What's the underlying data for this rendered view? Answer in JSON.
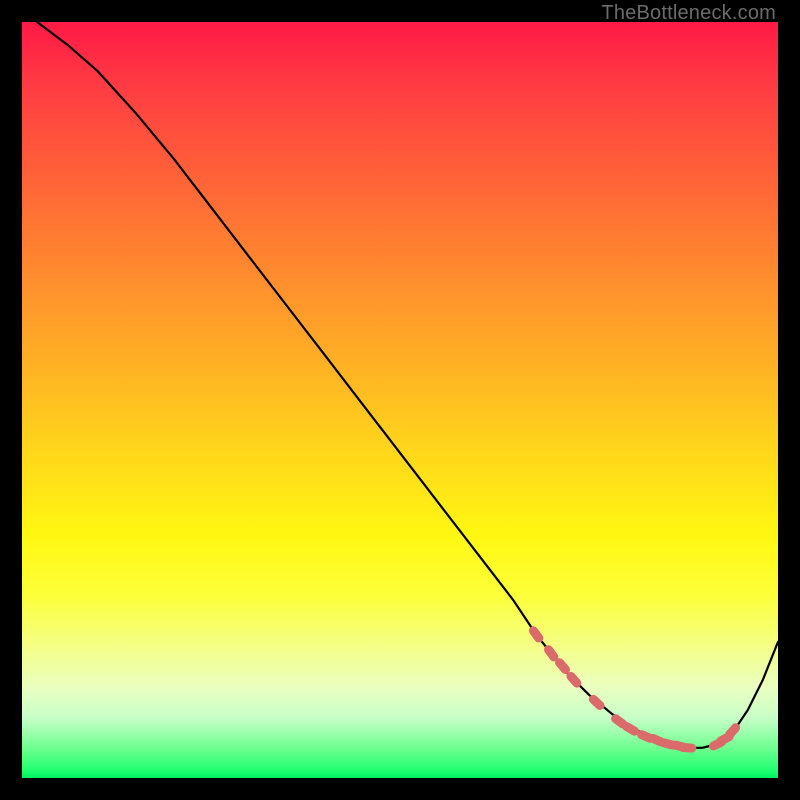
{
  "watermark": "TheBottleneck.com",
  "colors": {
    "background": "#000000",
    "gradient_top": "#ff1a45",
    "gradient_bottom": "#00f060",
    "curve": "#000000",
    "marker": "#db6b6b"
  },
  "chart_data": {
    "type": "line",
    "title": "",
    "xlabel": "",
    "ylabel": "",
    "xlim": [
      0,
      100
    ],
    "ylim": [
      0,
      100
    ],
    "series": [
      {
        "name": "curve",
        "x": [
          2,
          6,
          10,
          15,
          20,
          25,
          30,
          35,
          40,
          45,
          50,
          55,
          60,
          65,
          68,
          72,
          75,
          78,
          81,
          84,
          86,
          88,
          90,
          92,
          94,
          96,
          98,
          100
        ],
        "y": [
          100,
          97,
          93.5,
          88,
          82,
          75.5,
          69,
          62.5,
          56,
          49.5,
          43,
          36.5,
          30,
          23.5,
          19,
          14,
          11,
          8.5,
          6.5,
          5,
          4.3,
          4,
          4,
          4.5,
          6,
          9,
          13,
          18
        ]
      }
    ],
    "markers": {
      "name": "highlight-points",
      "x": [
        68,
        70,
        71.5,
        73,
        76,
        79,
        80.5,
        82.5,
        84,
        85.5,
        87,
        88,
        92,
        93,
        94
      ],
      "y": [
        19,
        16.5,
        14.8,
        13,
        10,
        7.5,
        6.5,
        5.5,
        5,
        4.5,
        4.2,
        4,
        4.5,
        5.2,
        6.2
      ]
    }
  }
}
